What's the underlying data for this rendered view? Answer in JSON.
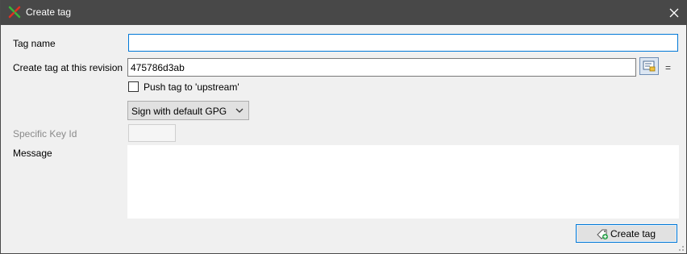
{
  "window": {
    "title": "Create tag",
    "title_icon": "git-tag-icon",
    "close_icon": "close-icon"
  },
  "form": {
    "tag_name_label": "Tag name",
    "tag_name_value": "",
    "revision_label": "Create tag at this revision",
    "revision_value": "475786d3ab",
    "revision_suffix": "=",
    "push_label": "Push tag to 'upstream'",
    "push_checked": false,
    "sign_selected": "Sign with default GPG",
    "key_id_label": "Specific Key Id",
    "key_id_value": "",
    "message_label": "Message",
    "message_value": ""
  },
  "actions": {
    "create_label": "Create tag"
  },
  "colors": {
    "titlebar": "#484848",
    "accent": "#0078d7",
    "background": "#f0f0f0"
  }
}
